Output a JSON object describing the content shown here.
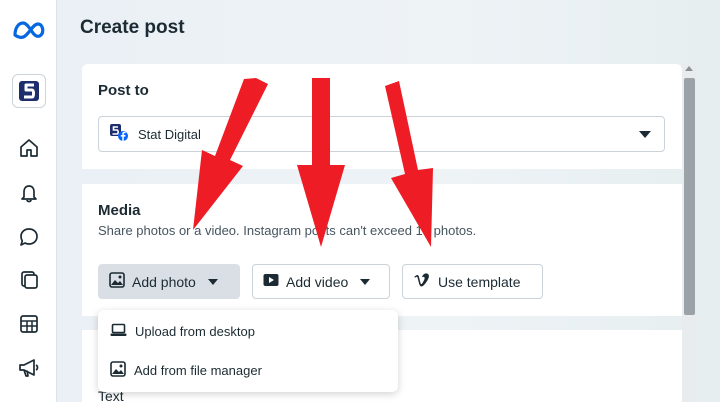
{
  "page": {
    "title": "Create post"
  },
  "sidebar": {
    "items": [
      {
        "icon": "meta-logo-icon"
      },
      {
        "icon": "account-avatar-icon"
      },
      {
        "icon": "home-icon"
      },
      {
        "icon": "bell-icon"
      },
      {
        "icon": "chat-bubble-icon"
      },
      {
        "icon": "pages-stack-icon"
      },
      {
        "icon": "table-grid-icon"
      },
      {
        "icon": "megaphone-icon"
      }
    ]
  },
  "post_to": {
    "heading": "Post to",
    "selected_account": "Stat Digital"
  },
  "media": {
    "heading": "Media",
    "subtitle": "Share photos or a video. Instagram posts can't exceed 10 photos.",
    "buttons": {
      "add_photo": "Add photo",
      "add_video": "Add video",
      "use_template": "Use template"
    },
    "dropdown": {
      "upload_desktop": "Upload from desktop",
      "file_manager": "Add from file manager"
    }
  },
  "text_section": {
    "heading": "Text"
  },
  "colors": {
    "annotation_arrow": "#ee1c24",
    "meta_blue": "#0668e1",
    "active_button": "#d9dfe5"
  }
}
